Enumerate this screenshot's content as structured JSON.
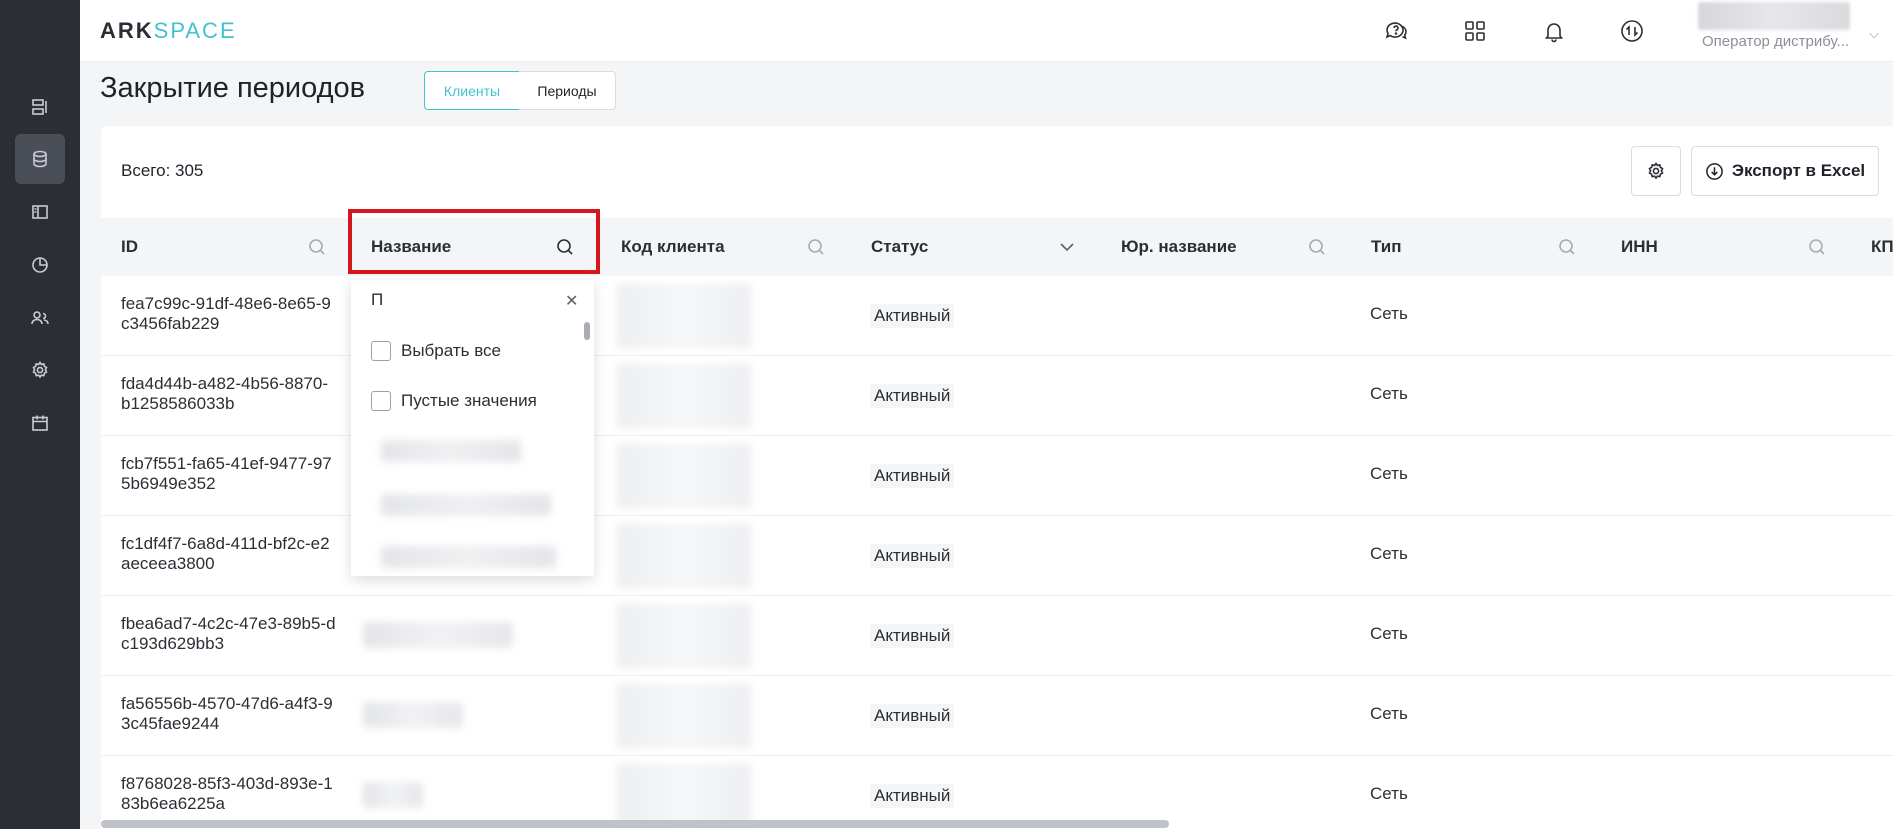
{
  "app": {
    "logo_ark": "ARK",
    "logo_space": "SPACE",
    "user_role": "Оператор дистрибу..."
  },
  "sidebar": {
    "items": [
      {
        "icon": "servers-icon"
      },
      {
        "icon": "database-icon",
        "active": true
      },
      {
        "icon": "panel-icon"
      },
      {
        "icon": "pie-chart-icon"
      },
      {
        "icon": "users-icon"
      },
      {
        "icon": "gear-icon"
      },
      {
        "icon": "calendar-icon"
      }
    ]
  },
  "header": {
    "icons": [
      "help-chat-icon",
      "apps-grid-icon",
      "bell-icon",
      "sync-icon"
    ]
  },
  "page": {
    "title": "Закрытие периодов",
    "tabs": [
      "Клиенты",
      "Периоды"
    ],
    "active_tab": "Клиенты"
  },
  "toolbar": {
    "total": "Всего: 305",
    "export_label": "Экспорт в Excel"
  },
  "table": {
    "columns": [
      "ID",
      "Название",
      "Код клиента",
      "Статус",
      "Юр. название",
      "Тип",
      "ИНН",
      "КП"
    ],
    "rows": [
      {
        "id": "fea7c99c-91df-48e6-8e65-9c3456fab229",
        "status": "Активный",
        "type": "Сеть"
      },
      {
        "id": "fda4d44b-a482-4b56-8870-b1258586033b",
        "status": "Активный",
        "type": "Сеть"
      },
      {
        "id": "fcb7f551-fa65-41ef-9477-975b6949e352",
        "status": "Активный",
        "type": "Сеть"
      },
      {
        "id": "fc1df4f7-6a8d-411d-bf2c-e2aeceea3800",
        "status": "Активный",
        "type": "Сеть"
      },
      {
        "id": "fbea6ad7-4c2c-47e3-89b5-dc193d629bb3",
        "status": "Активный",
        "type": "Сеть"
      },
      {
        "id": "fa56556b-4570-47d6-a4f3-93c45fae9244",
        "status": "Активный",
        "type": "Сеть"
      },
      {
        "id": "f8768028-85f3-403d-893e-183b6ea6225a",
        "status": "Активный",
        "type": "Сеть"
      }
    ]
  },
  "filter_dropdown": {
    "search_value": "П",
    "select_all": "Выбрать все",
    "empty_values": "Пустые значения"
  }
}
